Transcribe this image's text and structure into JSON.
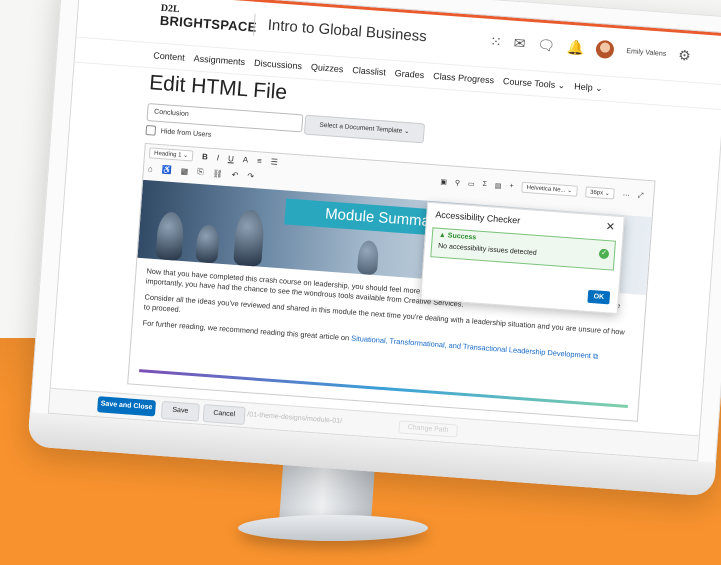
{
  "header": {
    "logo_top": "D2L",
    "logo_bottom": "BRIGHTSPACE",
    "course_title": "Intro to Global Business",
    "user_name": "Emily Valens"
  },
  "nav": {
    "items": [
      "Content",
      "Assignments",
      "Discussions",
      "Quizzes",
      "Classlist",
      "Grades",
      "Class Progress",
      "Course Tools ⌄",
      "Help ⌄"
    ]
  },
  "page": {
    "title": "Edit HTML File",
    "title_field_value": "Conclusion",
    "template_button": "Select a Document Template",
    "hide_label": "Hide from Users"
  },
  "toolbar": {
    "format_select": "Heading 1",
    "font_select": "Helvetica Ne...",
    "size_select": "36px"
  },
  "banner": {
    "title": "Module Summa"
  },
  "content": {
    "p1": "Now that you have completed this crash course on leadership, you should feel more comfortable in your current and future leadership roles. More importantly, you have had the chance to see the wondrous tools available from Creative Services.",
    "p2": "Consider all the ideas you've reviewed and shared in this module the next time you're dealing with a leadership situation and you are unsure of how to proceed.",
    "p3_prefix": "For further reading, we recommend reading this great article on ",
    "p3_link": "Situational, Transformational, and Transactional Leadership Development"
  },
  "modal": {
    "title": "Accessibility Checker",
    "status": "Success",
    "message": "No accessibility issues detected",
    "ok": "OK"
  },
  "footer": {
    "save_close": "Save and Close",
    "save": "Save",
    "cancel": "Cancel",
    "path": "/01-theme-designs/module-01/",
    "change_path": "Change Path"
  }
}
